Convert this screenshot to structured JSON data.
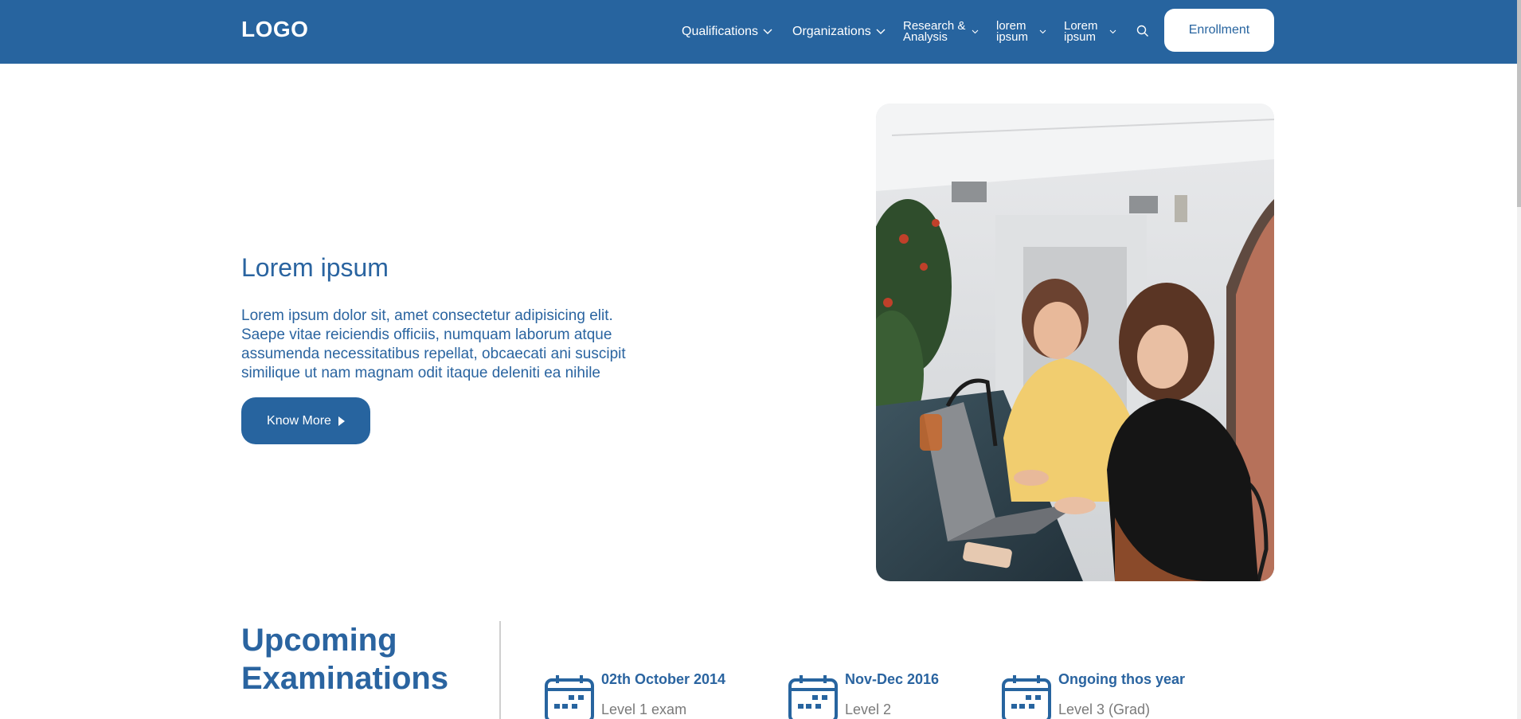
{
  "header": {
    "logo": "LOGO",
    "nav": [
      {
        "label": "Qualifications",
        "lines": [
          "Qualifications"
        ]
      },
      {
        "label": "Organizations",
        "lines": [
          "Organizations"
        ]
      },
      {
        "label": "Research & Analysis",
        "lines": [
          "Research &",
          "Analysis"
        ]
      },
      {
        "label": "lorem ipsum",
        "lines": [
          "lorem",
          "ipsum"
        ]
      },
      {
        "label": "Lorem ipsum",
        "lines": [
          "Lorem",
          "ipsum"
        ]
      }
    ],
    "search_icon": "search-icon",
    "enroll_label": "Enrollment"
  },
  "hero": {
    "title": "Lorem ipsum",
    "text_lines": [
      "Lorem ipsum dolor sit, amet consectetur adipisicing elit.",
      "Saepe vitae reiciendis officiis, numquam laborum atque",
      "assumenda necessitatibus repellat, obcaecati ani suscipit",
      "similique ut nam magnam odit itaque deleniti ea nihile"
    ],
    "button_label": "Know More"
  },
  "upcoming": {
    "title_lines": [
      "Upcoming",
      "Examinations"
    ],
    "exams": [
      {
        "date": "02th October 2014",
        "level": "Level 1 exam"
      },
      {
        "date": "Nov-Dec 2016",
        "level": "Level 2"
      },
      {
        "date": "Ongoing thos year",
        "level": "Level 3 (Grad)"
      }
    ]
  },
  "colors": {
    "brand": "#27649f",
    "text_blue": "#2a64a0",
    "muted": "#7a7a7a"
  }
}
